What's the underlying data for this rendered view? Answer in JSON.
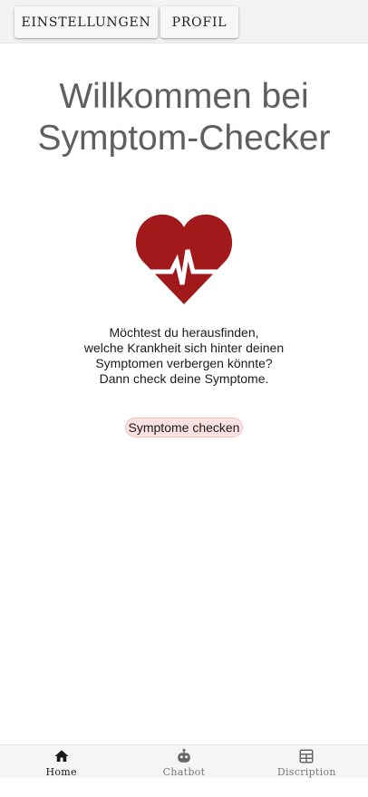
{
  "top_buttons": {
    "settings_label": "EINSTELLUNGEN",
    "profile_label": "PROFIL"
  },
  "main": {
    "title_line1": "Willkommen bei",
    "title_line2": "Symptom-Checker",
    "intro_lines": [
      "Möchtest du herausfinden,",
      "welche Krankheit sich hinter deinen",
      "Symptomen verbergen könnte?",
      "Dann check deine Symptome."
    ],
    "check_button_label": "Symptome checken",
    "heart_icon": "heart-pulse-icon"
  },
  "bottom_nav": {
    "items": [
      {
        "label": "Home",
        "icon": "home-icon",
        "active": true
      },
      {
        "label": "Chatbot",
        "icon": "robot-icon",
        "active": false
      },
      {
        "label": "Discription",
        "icon": "table-icon",
        "active": false
      }
    ]
  },
  "colors": {
    "heart": "#a2191c",
    "check_button_bg": "#fbe1e1",
    "title_text": "#5f5f5f",
    "active_nav": "#1a1a1a",
    "inactive_nav": "#777777"
  }
}
